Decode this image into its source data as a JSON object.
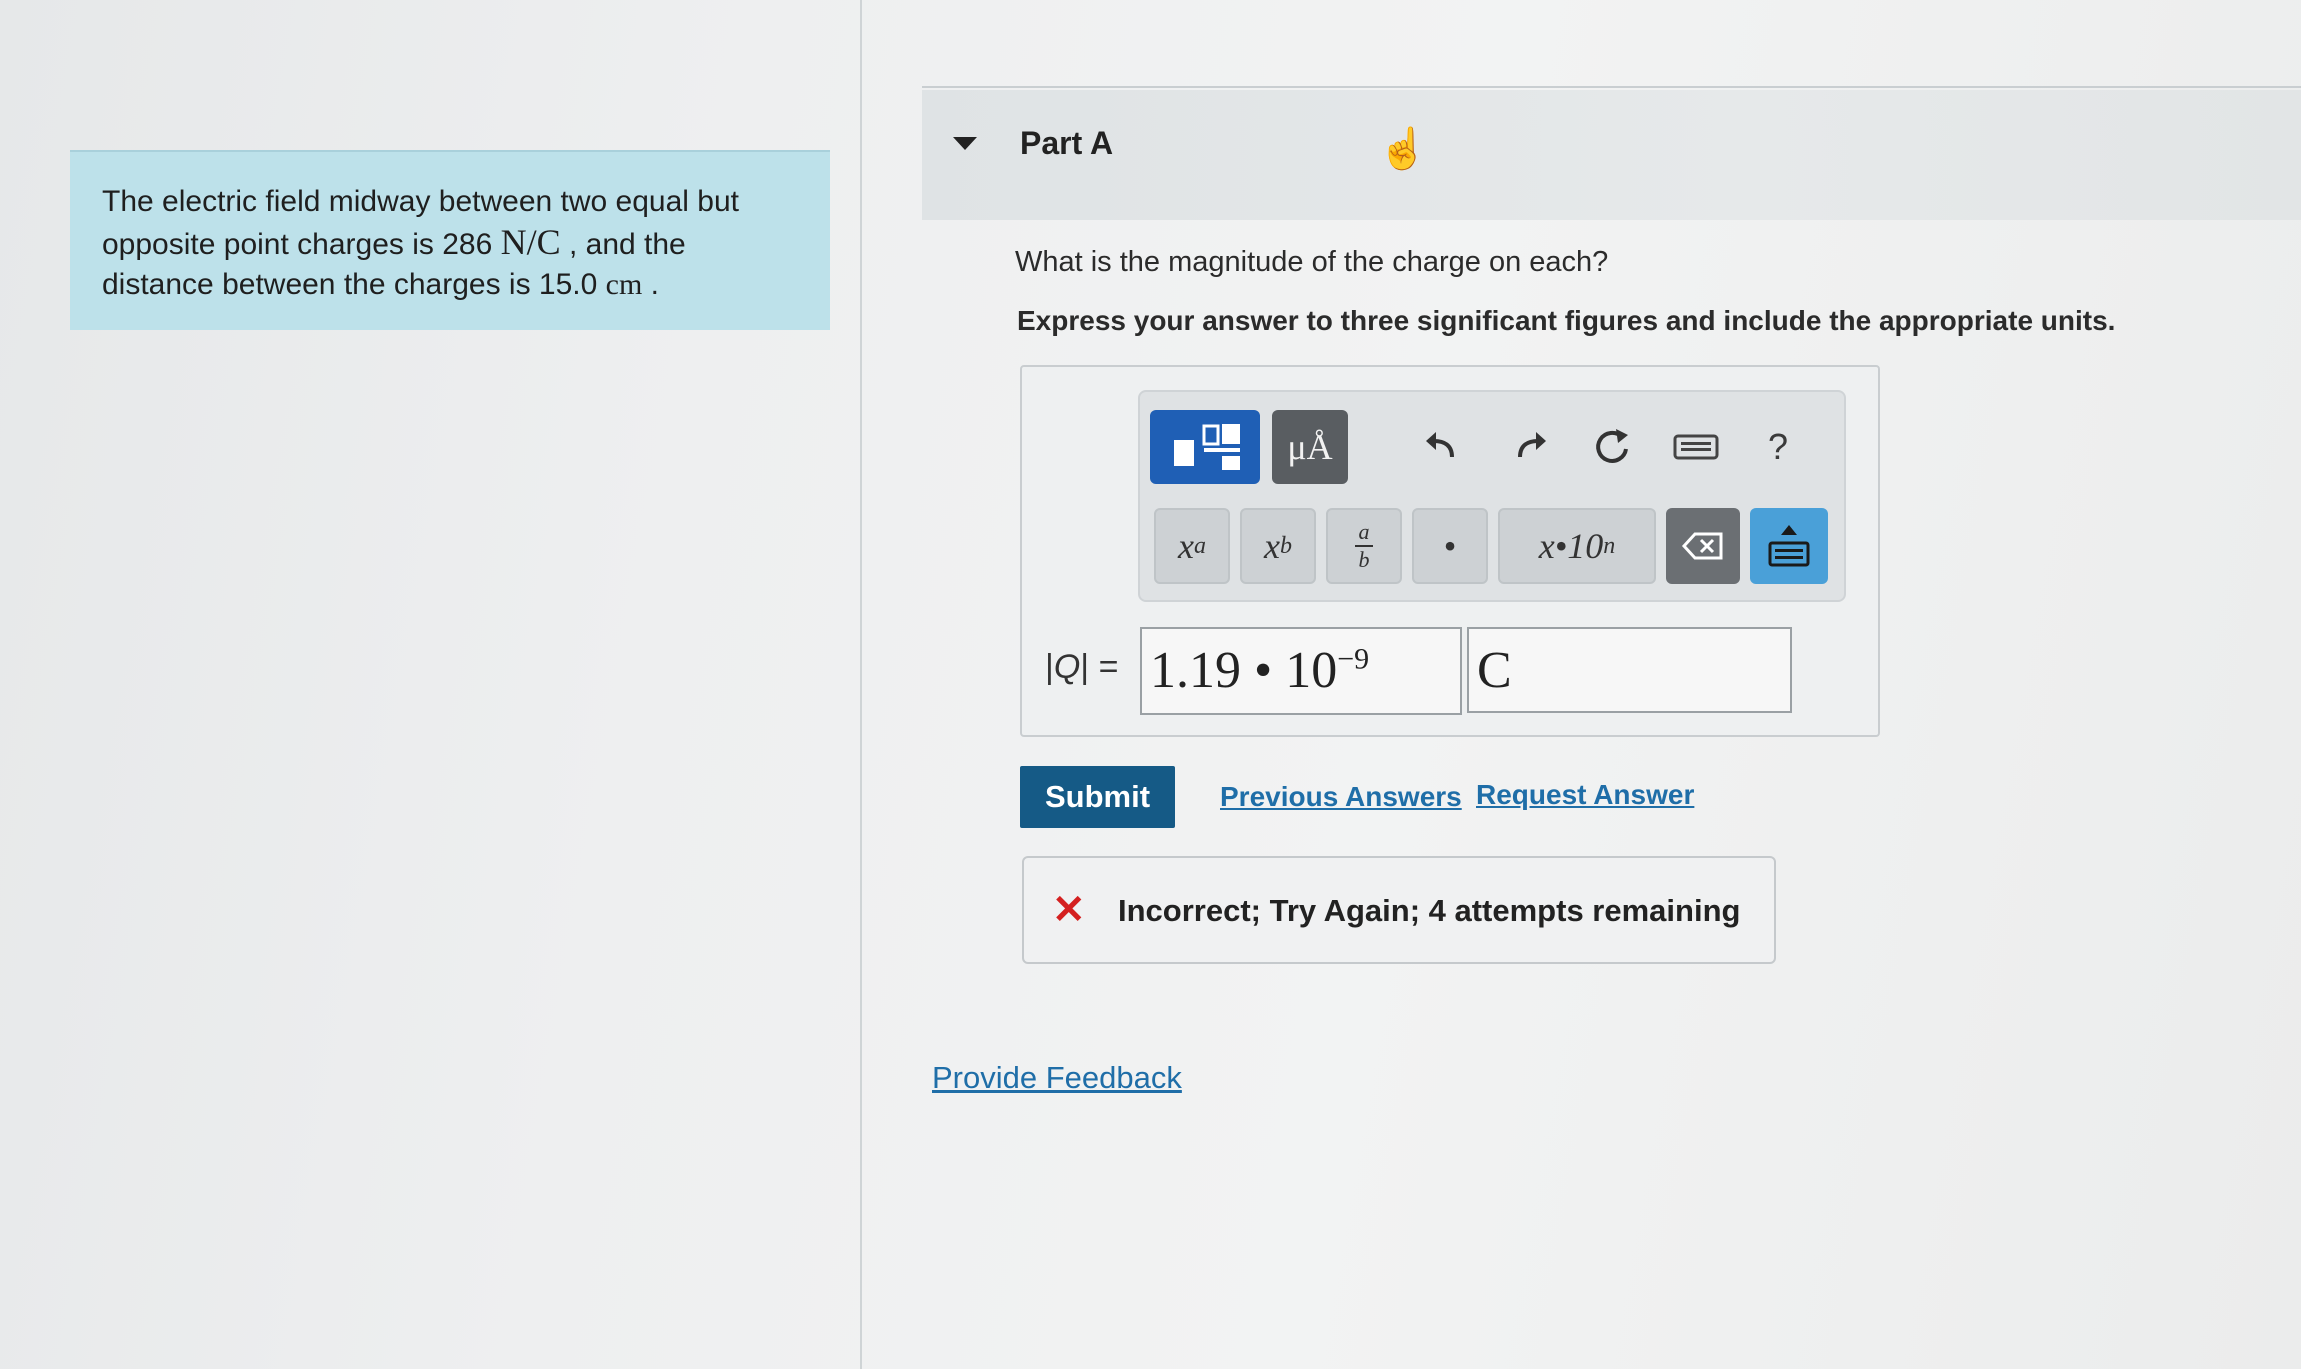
{
  "problem": {
    "line1": "The electric field midway between two equal but",
    "line2_prefix": "opposite point charges is 286 ",
    "field_unit": "N/C",
    "line2_suffix": " , and the",
    "line3_prefix": "distance between the charges is 15.0 ",
    "distance_unit": "cm",
    "line3_suffix": " ."
  },
  "part": {
    "title": "Part A",
    "question": "What is the magnitude of the charge on each?",
    "instruction": "Express your answer to three significant figures and include the appropriate units."
  },
  "toolbar": {
    "units_label": "μÅ",
    "help_label": "?",
    "superscript_base": "x",
    "superscript_exp": "a",
    "subscript_base": "x",
    "subscript_sub": "b",
    "fraction_num": "a",
    "fraction_den": "b",
    "dot_label": "•",
    "sci_label": "x•10",
    "sci_exp": "n"
  },
  "answer": {
    "label_var": "Q",
    "label_suffix": "| =",
    "label_prefix": "|",
    "mantissa": "1.19 • 10",
    "exponent": "−9",
    "unit": "C"
  },
  "actions": {
    "submit": "Submit",
    "previous_answers": "Previous Answers",
    "request_answer": "Request Answer"
  },
  "feedback": {
    "icon": "✕",
    "message": "Incorrect; Try Again; 4 attempts remaining"
  },
  "footer": {
    "provide_feedback": "Provide Feedback"
  },
  "colors": {
    "problem_bg": "#bde1ea",
    "submit_bg": "#155a86",
    "template_btn": "#1f5fb5",
    "link": "#1f6ea8",
    "error": "#d42020"
  }
}
